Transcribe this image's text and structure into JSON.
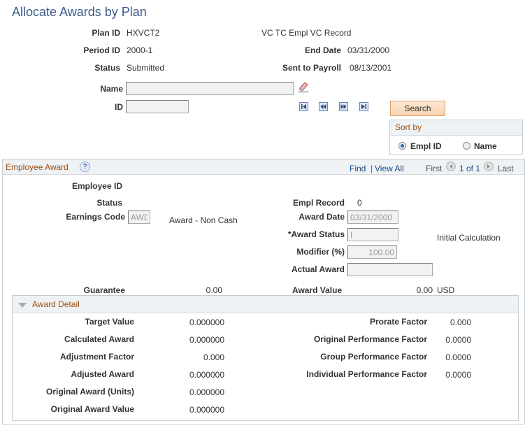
{
  "page": {
    "title": "Allocate Awards by Plan"
  },
  "header": {
    "plan_id_label": "Plan ID",
    "plan_id": "HXVCT2",
    "plan_description": "VC TC Empl VC Record",
    "period_id_label": "Period ID",
    "period_id": "2000-1",
    "end_date_label": "End Date",
    "end_date": "03/31/2000",
    "status_label": "Status",
    "status": "Submitted",
    "sent_to_payroll_label": "Sent to Payroll",
    "sent_to_payroll": "08/13/2001"
  },
  "search": {
    "name_label": "Name",
    "name_value": "",
    "id_label": "ID",
    "id_value": "",
    "search_button": "Search",
    "sort_by_title": "Sort by",
    "sort_options": [
      {
        "label": "Empl ID",
        "selected": true
      },
      {
        "label": "Name",
        "selected": false
      }
    ],
    "nav_icons": [
      "first-page-icon",
      "previous-page-icon",
      "next-page-icon",
      "last-page-icon"
    ],
    "clear_icon": "eraser-icon"
  },
  "employee_award": {
    "title": "Employee Award",
    "help_icon": "?",
    "find_link": "Find",
    "separator": "|",
    "view_all_link": "View All",
    "first_label": "First",
    "pagination": "1 of 1",
    "last_label": "Last",
    "employee_id_label": "Employee ID",
    "employee_id": "",
    "status_label": "Status",
    "status": "",
    "empl_record_label": "Empl Record",
    "empl_record": "0",
    "earnings_code_label": "Earnings Code",
    "earnings_code": "AWD",
    "earnings_code_desc": "Award - Non Cash",
    "award_date_label": "Award Date",
    "award_date": "03/31/2000",
    "award_status_label": "*Award Status",
    "award_status": "I",
    "award_status_desc": "Initial Calculation",
    "modifier_label": "Modifier (%)",
    "modifier": "100.00",
    "actual_award_label": "Actual Award",
    "actual_award": "",
    "guarantee_label": "Guarantee",
    "guarantee": "0.00",
    "award_value_label": "Award Value",
    "award_value": "0.00",
    "currency": "USD"
  },
  "award_detail": {
    "title": "Award Detail",
    "left": [
      {
        "label": "Target Value",
        "value": "0.000000"
      },
      {
        "label": "Calculated Award",
        "value": "0.000000"
      },
      {
        "label": "Adjustment Factor",
        "value": "0.000"
      },
      {
        "label": "Adjusted Award",
        "value": "0.000000"
      },
      {
        "label": "Original Award (Units)",
        "value": "0.000000"
      },
      {
        "label": "Original Award Value",
        "value": "0.000000"
      }
    ],
    "right": [
      {
        "label": "Prorate Factor",
        "value": "0.000"
      },
      {
        "label": "Original Performance Factor",
        "value": "0.0000"
      },
      {
        "label": "Group Performance Factor",
        "value": "0.0000"
      },
      {
        "label": "Individual Performance Factor",
        "value": "0.0000"
      }
    ]
  }
}
